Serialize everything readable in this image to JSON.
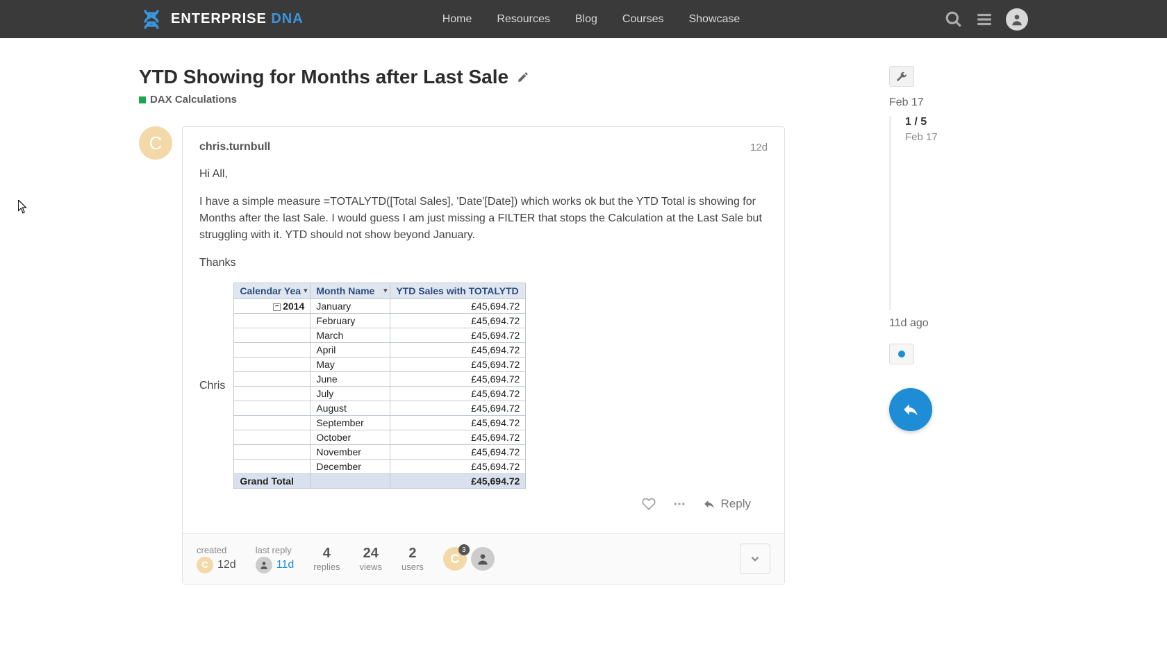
{
  "header": {
    "brand_a": "ENTERPRISE ",
    "brand_b": "DNA",
    "nav": [
      "Home",
      "Resources",
      "Blog",
      "Courses",
      "Showcase"
    ]
  },
  "topic": {
    "title": "YTD Showing for Months after Last Sale",
    "category": "DAX Calculations"
  },
  "post": {
    "author": "chris.turnbull",
    "avatar_initial": "C",
    "age": "12d",
    "p1": "Hi All,",
    "p2": "I have a simple measure =TOTALYTD([Total Sales], 'Date'[Date]) which works ok but the YTD Total is showing for Months after the last Sale. I would guess I am just missing a FILTER that stops the Calculation at the Last Sale but struggling with it. YTD should not show beyond January.",
    "p3": "Thanks",
    "signature": "Chris",
    "reply_label": "Reply"
  },
  "table": {
    "h1": "Calendar Yea",
    "h2": "Month Name",
    "h3": "YTD Sales with TOTALYTD",
    "year": "2014",
    "rows": [
      {
        "m": "January",
        "v": "£45,694.72"
      },
      {
        "m": "February",
        "v": "£45,694.72"
      },
      {
        "m": "March",
        "v": "£45,694.72"
      },
      {
        "m": "April",
        "v": "£45,694.72"
      },
      {
        "m": "May",
        "v": "£45,694.72"
      },
      {
        "m": "June",
        "v": "£45,694.72"
      },
      {
        "m": "July",
        "v": "£45,694.72"
      },
      {
        "m": "August",
        "v": "£45,694.72"
      },
      {
        "m": "September",
        "v": "£45,694.72"
      },
      {
        "m": "October",
        "v": "£45,694.72"
      },
      {
        "m": "November",
        "v": "£45,694.72"
      },
      {
        "m": "December",
        "v": "£45,694.72"
      }
    ],
    "total_label": "Grand Total",
    "total_value": "£45,694.72"
  },
  "summary": {
    "created_label": "created",
    "created_value": "12d",
    "lastreply_label": "last reply",
    "lastreply_value": "11d",
    "replies_n": "4",
    "replies_l": "replies",
    "views_n": "24",
    "views_l": "views",
    "users_n": "2",
    "users_l": "users",
    "badge": "3"
  },
  "timeline": {
    "top_date": "Feb 17",
    "pos": "1 / 5",
    "pos_date": "Feb 17",
    "bottom": "11d ago"
  }
}
